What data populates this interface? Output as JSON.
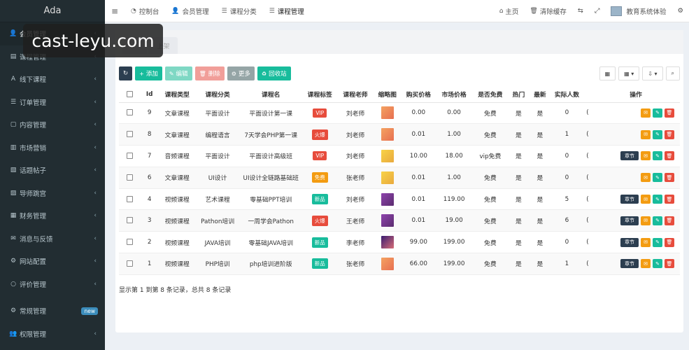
{
  "sidebar": {
    "logo": "Ada",
    "items": [
      {
        "label": "会员管理",
        "icon": "user-icon"
      },
      {
        "label": "课程管理",
        "icon": "book-icon"
      },
      {
        "label": "线下课程",
        "icon": "font-icon"
      },
      {
        "label": "订单管理",
        "icon": "list-icon"
      },
      {
        "label": "内容管理",
        "icon": "content-icon"
      },
      {
        "label": "市场营销",
        "icon": "chart-icon"
      },
      {
        "label": "话题帖子",
        "icon": "topic-icon"
      },
      {
        "label": "导师跳宫",
        "icon": "tutor-icon"
      },
      {
        "label": "财务管理",
        "icon": "bank-icon"
      },
      {
        "label": "消息与反馈",
        "icon": "message-icon"
      },
      {
        "label": "网站配置",
        "icon": "gear-icon"
      },
      {
        "label": "评价管理",
        "icon": "circle-icon"
      }
    ],
    "bottom": [
      {
        "label": "常规管理",
        "icon": "cogs-icon",
        "badge": "new"
      },
      {
        "label": "权限管理",
        "icon": "users-icon"
      }
    ]
  },
  "watermark": "cast-leyu.com",
  "topbar": {
    "tabs": [
      {
        "label": "控制台",
        "icon": "dashboard-icon"
      },
      {
        "label": "会员管理",
        "icon": "user-icon"
      },
      {
        "label": "课程分类",
        "icon": "list-icon"
      },
      {
        "label": "课程管理",
        "icon": "list-icon"
      }
    ],
    "right": {
      "home": "主页",
      "clear_cache": "清除缓存",
      "user_name": "教育系统体验"
    }
  },
  "panel": {
    "head_tabs": [
      "上架"
    ]
  },
  "toolbar": {
    "add": "添加",
    "edit": "编辑",
    "delete": "删除",
    "more": "更多",
    "recycle": "回收站"
  },
  "table": {
    "headers": [
      "Id",
      "课程类型",
      "课程分类",
      "课程名",
      "课程标签",
      "课程老师",
      "缩略图",
      "购买价格",
      "市场价格",
      "是否免费",
      "热门",
      "最新",
      "实际人数",
      "操作"
    ],
    "rows": [
      {
        "id": "9",
        "type": "文章课程",
        "type_style": "article",
        "category": "平面设计",
        "name": "平面设计第一课",
        "tag": "VIP",
        "tag_color": "red",
        "teacher": "刘老师",
        "teacher_color": "orange",
        "thumb": "orange",
        "price": "0.00",
        "market": "0.00",
        "free": "免费",
        "free_color": "gray",
        "hot": "是",
        "new": "是",
        "count": "0",
        "chapter": false
      },
      {
        "id": "8",
        "type": "文章课程",
        "type_style": "article",
        "category": "编程语言",
        "name": "7天学会PHP第一课",
        "tag": "火爆",
        "tag_color": "red",
        "teacher": "刘老师",
        "teacher_color": "orange",
        "thumb": "orange",
        "price": "0.01",
        "market": "1.00",
        "free": "免费",
        "free_color": "gray",
        "hot": "是",
        "new": "是",
        "count": "1",
        "chapter": false
      },
      {
        "id": "7",
        "type": "音频课程",
        "type_style": "audio",
        "category": "平面设计",
        "name": "平面设计高级班",
        "tag": "VIP",
        "tag_color": "red",
        "teacher": "刘老师",
        "teacher_color": "orange",
        "thumb": "yellow",
        "price": "10.00",
        "market": "18.00",
        "free": "vip免费",
        "free_color": "green",
        "hot": "是",
        "new": "是",
        "count": "0",
        "chapter": true
      },
      {
        "id": "6",
        "type": "文章课程",
        "type_style": "article",
        "category": "UI设计",
        "name": "UI设计全链路基础班",
        "tag": "免费",
        "tag_color": "orange",
        "teacher": "张老师",
        "teacher_color": "orange",
        "thumb": "yellow",
        "price": "0.01",
        "market": "1.00",
        "free": "免费",
        "free_color": "gray",
        "hot": "是",
        "new": "是",
        "count": "0",
        "chapter": false
      },
      {
        "id": "4",
        "type": "视频课程",
        "type_style": "plain",
        "category": "艺术课程",
        "name": "零基础PPT培训",
        "tag": "新品",
        "tag_color": "green",
        "teacher": "刘老师",
        "teacher_color": "orange",
        "thumb": "purple",
        "price": "0.01",
        "market": "119.00",
        "free": "免费",
        "free_color": "gray",
        "hot": "是",
        "new": "是",
        "count": "5",
        "chapter": true
      },
      {
        "id": "3",
        "type": "视频课程",
        "type_style": "plain",
        "category": "Pathon培训",
        "name": "一周学会Pathon",
        "tag": "火爆",
        "tag_color": "red",
        "teacher": "王老师",
        "teacher_color": "green",
        "thumb": "purple",
        "price": "0.01",
        "market": "19.00",
        "free": "免费",
        "free_color": "gray",
        "hot": "是",
        "new": "是",
        "count": "6",
        "chapter": true
      },
      {
        "id": "2",
        "type": "视频课程",
        "type_style": "plain",
        "category": "JAVA培训",
        "name": "零基础JAVA培训",
        "tag": "新品",
        "tag_color": "green",
        "teacher": "李老师",
        "teacher_color": "gray",
        "thumb": "dark",
        "price": "99.00",
        "market": "199.00",
        "free": "免费",
        "free_color": "gray",
        "hot": "是",
        "new": "是",
        "count": "0",
        "chapter": true
      },
      {
        "id": "1",
        "type": "视频课程",
        "type_style": "plain",
        "category": "PHP培训",
        "name": "php培训进阶版",
        "tag": "新品",
        "tag_color": "green",
        "teacher": "张老师",
        "teacher_color": "orange",
        "thumb": "orange",
        "price": "66.00",
        "market": "199.00",
        "free": "免费",
        "free_color": "gray",
        "hot": "是",
        "new": "是",
        "count": "1",
        "chapter": true
      }
    ],
    "chapter_label": "章节",
    "extra_col": "("
  },
  "footer": "显示第 1 到第 8 条记录，总共 8 条记录"
}
